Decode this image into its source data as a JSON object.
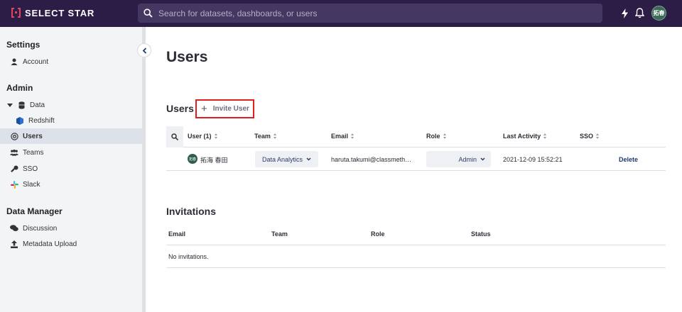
{
  "app": {
    "logo_text": "SELECT STAR"
  },
  "search": {
    "placeholder": "Search for datasets, dashboards, or users"
  },
  "header": {
    "avatar_initials": "拓春"
  },
  "sidebar": {
    "settings_title": "Settings",
    "account_label": "Account",
    "admin_title": "Admin",
    "data_label": "Data",
    "redshift_label": "Redshift",
    "users_label": "Users",
    "teams_label": "Teams",
    "sso_label": "SSO",
    "slack_label": "Slack",
    "data_manager_title": "Data Manager",
    "discussion_label": "Discussion",
    "metadata_upload_label": "Metadata Upload"
  },
  "main": {
    "page_title": "Users",
    "users_section_title": "Users",
    "invite_button_label": "Invite User",
    "users_table": {
      "columns": {
        "user": "User (1)",
        "team": "Team",
        "email": "Email",
        "role": "Role",
        "last_activity": "Last Activity",
        "sso": "SSO"
      },
      "rows": [
        {
          "avatar": "拓春",
          "name": "拓海 春田",
          "team": "Data Analytics",
          "email": "haruta.takumi@classmeth…",
          "role": "Admin",
          "last_activity": "2021-12-09 15:52:21",
          "action": "Delete"
        }
      ]
    },
    "invitations_title": "Invitations",
    "invitations_table": {
      "columns": {
        "email": "Email",
        "team": "Team",
        "role": "Role",
        "status": "Status"
      },
      "empty_text": "No invitations."
    }
  },
  "colors": {
    "topbar": "#2b1d45",
    "brand_red": "#e2445c",
    "highlight_border": "#e01f1f",
    "sidebar_bg": "#f3f4f6",
    "sidebar_active": "#dde1ea",
    "link": "#1e3a6b"
  },
  "icons": [
    "search-icon",
    "lightning-icon",
    "bell-icon",
    "user-icon",
    "database-icon",
    "redshift-icon",
    "at-icon",
    "team-icon",
    "key-icon",
    "slack-icon",
    "discussion-icon",
    "upload-icon",
    "chevron-left-icon",
    "plus-icon",
    "chevron-down-icon"
  ]
}
